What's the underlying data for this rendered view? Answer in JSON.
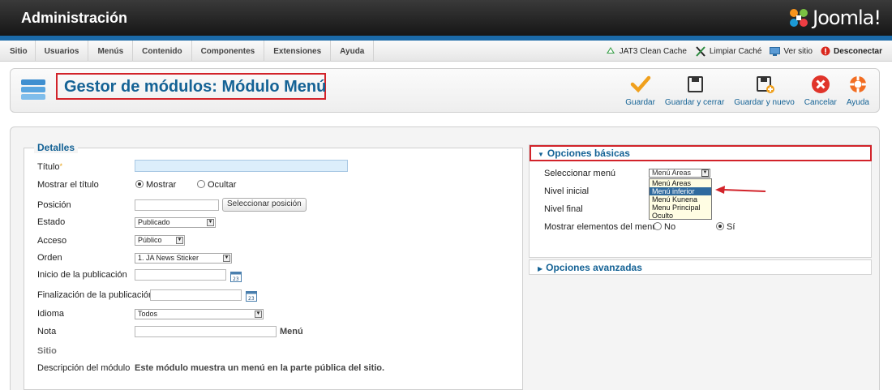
{
  "header": {
    "brand": "Administración",
    "logo_text": "Joomla!"
  },
  "menu": [
    "Sitio",
    "Usuarios",
    "Menús",
    "Contenido",
    "Componentes",
    "Extensiones",
    "Ayuda"
  ],
  "status": {
    "cache_jat3": "JAT3 Clean Cache",
    "clear_cache": "Limpiar Caché",
    "view_site": "Ver sitio",
    "logout": "Desconectar"
  },
  "toolbar": {
    "title": "Gestor de módulos: Módulo Menú",
    "save": "Guardar",
    "save_close": "Guardar y cerrar",
    "save_new": "Guardar y nuevo",
    "cancel": "Cancelar",
    "help": "Ayuda"
  },
  "details": {
    "legend": "Detalles",
    "title_label": "Título",
    "title_required": "*",
    "title_value": "",
    "show_title_label": "Mostrar el título",
    "show_option": "Mostrar",
    "hide_option": "Ocultar",
    "position_label": "Posición",
    "position_value": "",
    "select_position_button": "Seleccionar posición",
    "state_label": "Estado",
    "state_value": "Publicado",
    "access_label": "Acceso",
    "access_value": "Público",
    "order_label": "Orden",
    "order_value": "1. JA News Sticker",
    "publish_up_label": "Inicio de la publicación",
    "publish_down_label": "Finalización de la publicación",
    "language_label": "Idioma",
    "language_value": "Todos",
    "note_label": "Nota",
    "note_suffix": "Menú",
    "site_label": "Sitio",
    "description_label": "Descripción del módulo",
    "description_value": "Este módulo muestra un menú en la parte pública del sitio."
  },
  "basic_options": {
    "heading": "Opciones básicas",
    "select_menu_label": "Seleccionar menú",
    "select_menu_value": "Menú Areas",
    "menu_options": [
      "Menú Areas",
      "Menú inferior",
      "Menú Kunena",
      "Menu Principal",
      "Oculto"
    ],
    "highlighted_option": "Menú inferior",
    "start_level_label": "Nivel inicial",
    "end_level_label": "Nivel final",
    "show_subitems_label": "Mostrar elementos del menú",
    "no_option": "No",
    "yes_option": "Sí"
  },
  "advanced_options": {
    "heading": "Opciones avanzadas"
  },
  "colors": {
    "accent": "#146295",
    "highlight": "#d2232a",
    "header_bg": "#161616",
    "strip": "#1b6aa8"
  }
}
